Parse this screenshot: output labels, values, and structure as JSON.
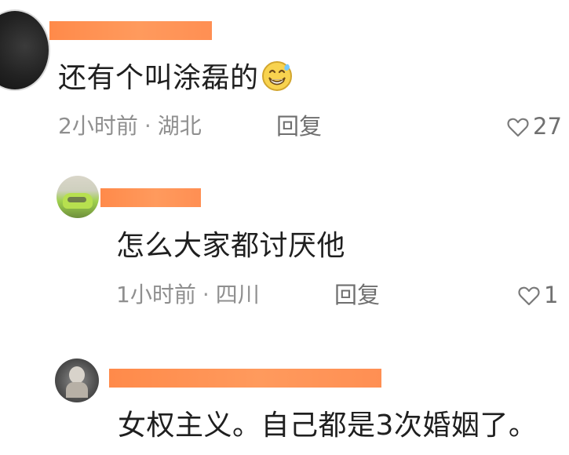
{
  "comments": [
    {
      "text": "还有个叫涂磊的",
      "emoji_icon": "grinning-sweat-emoji",
      "time": "2小时前",
      "location": "湖北",
      "reply_label": "回复",
      "likes": "27"
    },
    {
      "text": "怎么大家都讨厌他",
      "time": "1小时前",
      "location": "四川",
      "reply_label": "回复",
      "likes": "1"
    },
    {
      "text": "女权主义。自己都是3次婚姻了。"
    }
  ],
  "icons": {
    "heart": "heart-outline-icon"
  },
  "colors": {
    "name_mask": "#ff8f53",
    "meta_text": "#8f8f8f",
    "main_text": "#1f1f1f"
  }
}
